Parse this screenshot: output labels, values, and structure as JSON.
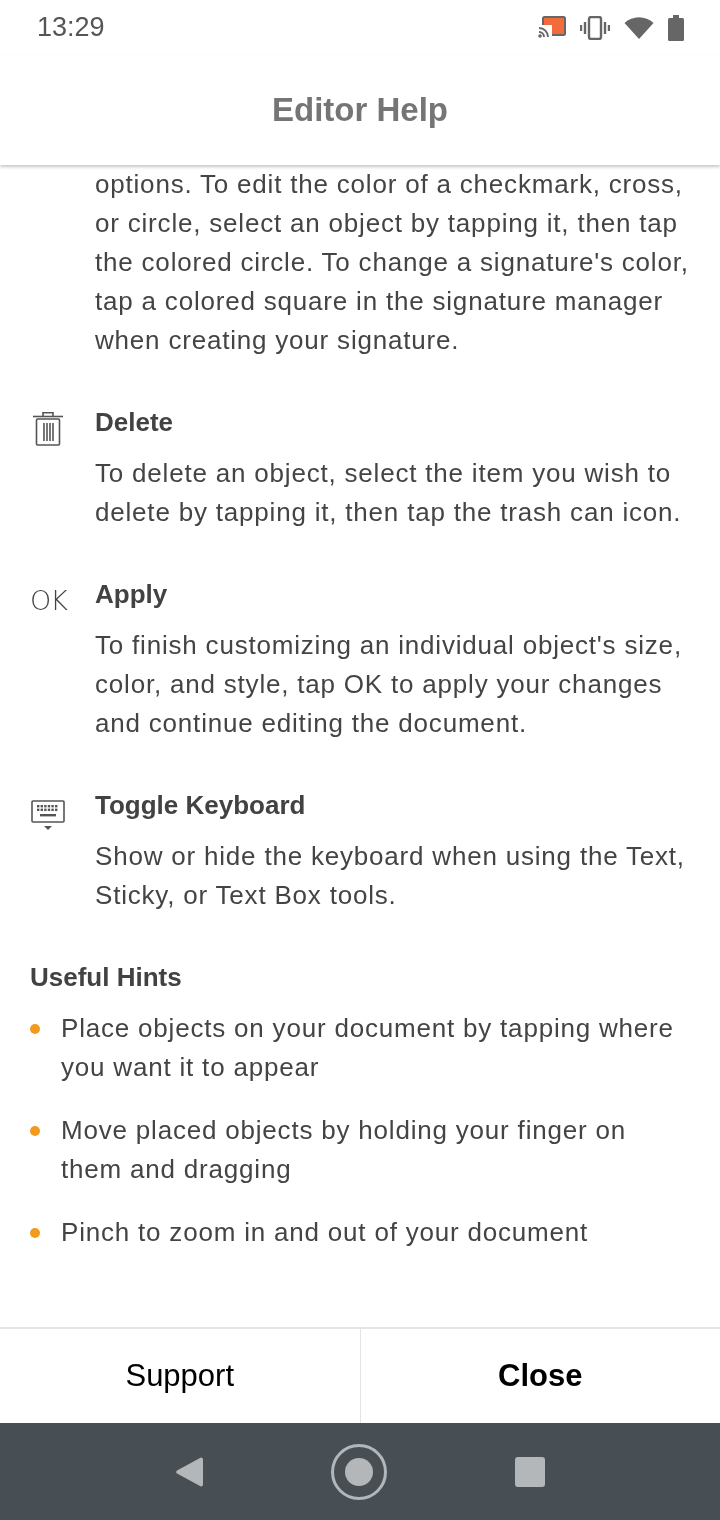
{
  "status_bar": {
    "time": "13:29"
  },
  "header": {
    "title": "Editor Help"
  },
  "sections": [
    {
      "kind": "continued",
      "description": "options. To edit the color of a checkmark, cross, or circle, select an object by tapping it, then tap the colored circle. To change a signature's color, tap a colored square in the signature manager when creating your signature."
    },
    {
      "kind": "trash",
      "heading": "Delete",
      "description": "To delete an object, select the item you wish to delete by tapping it, then tap the trash can icon."
    },
    {
      "kind": "text",
      "icon_text": "OK",
      "heading": "Apply",
      "description": "To finish customizing an individual object's size, color, and style, tap OK to apply your changes and continue editing the document."
    },
    {
      "kind": "keyboard",
      "heading": "Toggle Keyboard",
      "description": "Show or hide the keyboard when using the Text, Sticky, or Text Box tools."
    }
  ],
  "hints": {
    "heading": "Useful Hints",
    "items": [
      "Place objects on your document by tapping where you want it to appear",
      "Move placed objects by holding your finger on them and dragging",
      "Pinch to zoom in and out of your document"
    ]
  },
  "buttons": [
    {
      "label": "Support",
      "primary": false
    },
    {
      "label": "Close",
      "primary": true
    }
  ]
}
